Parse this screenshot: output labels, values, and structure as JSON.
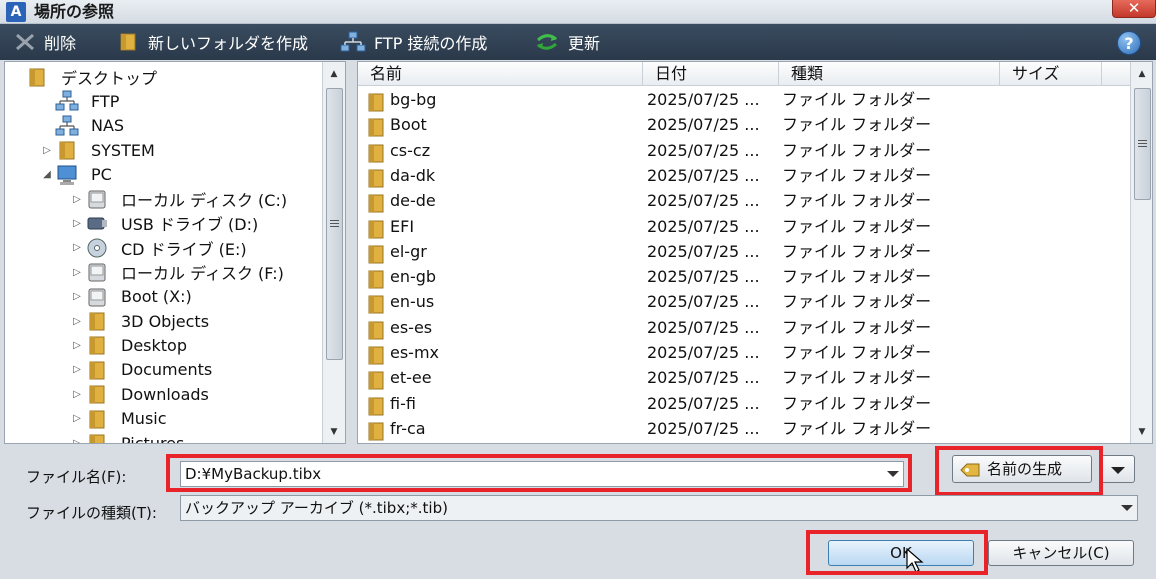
{
  "window": {
    "title": "場所の参照",
    "app_icon_letter": "A",
    "close_symbol": "✕"
  },
  "toolbar": {
    "delete": "削除",
    "new_folder": "新しいフォルダを作成",
    "ftp": "FTP 接続の作成",
    "refresh": "更新",
    "help": "?"
  },
  "tree": {
    "items": [
      {
        "label": "デスクトップ",
        "icon": "desktop-folder-icon",
        "arrow": "",
        "level": 0
      },
      {
        "label": "FTP",
        "icon": "network-icon",
        "arrow": "",
        "level": 1
      },
      {
        "label": "NAS",
        "icon": "network-icon",
        "arrow": "",
        "level": 1
      },
      {
        "label": "SYSTEM",
        "icon": "folder-icon",
        "arrow": "▷",
        "level": 1
      },
      {
        "label": "PC",
        "icon": "computer-icon",
        "arrow": "◢",
        "level": 1
      },
      {
        "label": "ローカル ディスク (C:)",
        "icon": "disk-icon",
        "arrow": "▷",
        "level": 2
      },
      {
        "label": "USB ドライブ (D:)",
        "icon": "usb-icon",
        "arrow": "▷",
        "level": 2
      },
      {
        "label": "CD ドライブ (E:)",
        "icon": "cd-icon",
        "arrow": "▷",
        "level": 2
      },
      {
        "label": "ローカル ディスク (F:)",
        "icon": "disk-icon",
        "arrow": "▷",
        "level": 2
      },
      {
        "label": "Boot (X:)",
        "icon": "disk-icon",
        "arrow": "▷",
        "level": 2
      },
      {
        "label": "3D Objects",
        "icon": "folder-icon",
        "arrow": "▷",
        "level": 2
      },
      {
        "label": "Desktop",
        "icon": "folder-icon",
        "arrow": "▷",
        "level": 2
      },
      {
        "label": "Documents",
        "icon": "folder-icon",
        "arrow": "▷",
        "level": 2
      },
      {
        "label": "Downloads",
        "icon": "folder-icon",
        "arrow": "▷",
        "level": 2
      },
      {
        "label": "Music",
        "icon": "folder-icon",
        "arrow": "▷",
        "level": 2
      },
      {
        "label": "Pictures",
        "icon": "folder-icon",
        "arrow": "▷",
        "level": 2
      }
    ]
  },
  "list": {
    "columns": [
      "名前",
      "日付",
      "種類",
      "サイズ"
    ],
    "rows": [
      {
        "name": "bg-bg",
        "date": "2025/07/25 ...",
        "type": "ファイル フォルダー"
      },
      {
        "name": "Boot",
        "date": "2025/07/25 ...",
        "type": "ファイル フォルダー"
      },
      {
        "name": "cs-cz",
        "date": "2025/07/25 ...",
        "type": "ファイル フォルダー"
      },
      {
        "name": "da-dk",
        "date": "2025/07/25 ...",
        "type": "ファイル フォルダー"
      },
      {
        "name": "de-de",
        "date": "2025/07/25 ...",
        "type": "ファイル フォルダー"
      },
      {
        "name": "EFI",
        "date": "2025/07/25 ...",
        "type": "ファイル フォルダー"
      },
      {
        "name": "el-gr",
        "date": "2025/07/25 ...",
        "type": "ファイル フォルダー"
      },
      {
        "name": "en-gb",
        "date": "2025/07/25 ...",
        "type": "ファイル フォルダー"
      },
      {
        "name": "en-us",
        "date": "2025/07/25 ...",
        "type": "ファイル フォルダー"
      },
      {
        "name": "es-es",
        "date": "2025/07/25 ...",
        "type": "ファイル フォルダー"
      },
      {
        "name": "es-mx",
        "date": "2025/07/25 ...",
        "type": "ファイル フォルダー"
      },
      {
        "name": "et-ee",
        "date": "2025/07/25 ...",
        "type": "ファイル フォルダー"
      },
      {
        "name": "fi-fi",
        "date": "2025/07/25 ...",
        "type": "ファイル フォルダー"
      },
      {
        "name": "fr-ca",
        "date": "2025/07/25 ...",
        "type": "ファイル フォルダー"
      }
    ]
  },
  "form": {
    "filename_label": "ファイル名(F):",
    "filename_value": "D:¥MyBackup.tibx",
    "filetype_label": "ファイルの種類(T):",
    "filetype_value": "バックアップ アーカイブ (*.tibx;*.tib)",
    "generate_name": "名前の生成"
  },
  "buttons": {
    "ok": "OK",
    "cancel": "キャンセル(C)"
  },
  "colors": {
    "highlight": "#e8232a",
    "toolbar": "#2f3f51",
    "folder": "#e0b040"
  }
}
